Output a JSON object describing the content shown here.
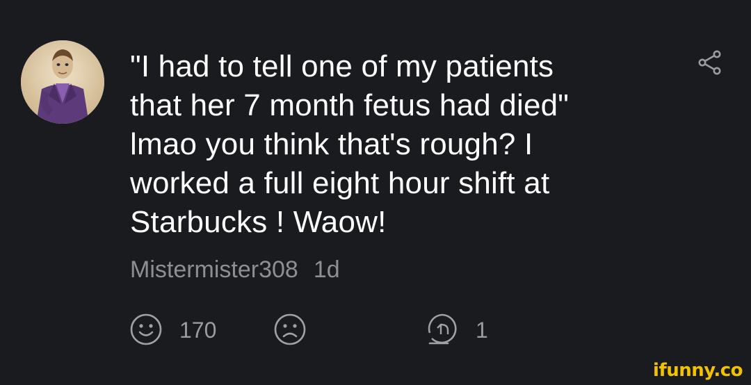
{
  "comment": {
    "text": "\"I had to tell one of my patients\nthat her 7 month fetus had died\"\nlmao you think that's rough? I\nworked a full eight hour shift at\nStarbucks ! Waow!",
    "username": "Mistermister308",
    "time_ago": "1d"
  },
  "actions": {
    "smile_count": "170",
    "reply_count": "1"
  },
  "icons": {
    "avatar": "avatar",
    "share": "share-icon",
    "smile": "smile-icon",
    "frown": "frown-icon",
    "reply": "reply-icon"
  },
  "watermark": "ifunny.co",
  "colors": {
    "background": "#1a1b1f",
    "text": "#ffffff",
    "muted": "#8e8f94",
    "brand": "#f2c200"
  }
}
